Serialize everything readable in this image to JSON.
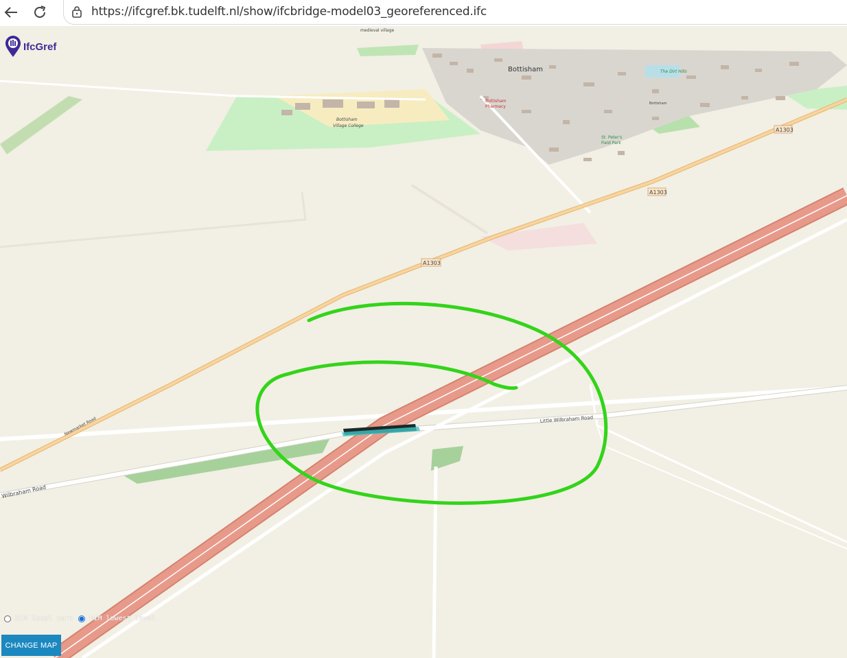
{
  "browser": {
    "url": "https://ifcgref.bk.tudelft.nl/show/ifcbridge-model03_georeferenced.ifc"
  },
  "app": {
    "logo_text": "IfcGref",
    "change_map_label": "CHANGE MAP",
    "radio_options": [
      {
        "label": "BIM local zero",
        "checked": false
      },
      {
        "label": "BIM lowest level",
        "checked": true
      }
    ]
  },
  "map_labels": {
    "medieval_village": "medieval village",
    "bottisham": "Bottisham",
    "the_dirt_hills": "The Dirt Hills",
    "village_college_1": "Bottisham",
    "village_college_2": "Village College",
    "pharmacy_1": "Bottisham",
    "pharmacy_2": "Pharmacy",
    "bottisham_small": "Bottisham",
    "field_park_1": "St. Peter's",
    "field_park_2": "Field Park",
    "a1303_1": "A1303",
    "a1303_2": "A1303",
    "a1303_3": "A1303",
    "newmarket_road": "Newmarket Road",
    "little_wilbraham_road": "Little Wilbraham Road",
    "wilbraham_road": "Wilbraham Road"
  },
  "colors": {
    "map_bg": "#f2efe4",
    "motorway": "#e89a8a",
    "a_road": "#f5c58a",
    "annotation": "#33d41a",
    "button": "#1b88c0"
  },
  "icons": [
    "back-arrow-icon",
    "reload-icon",
    "lock-icon",
    "ifcgref-pin-icon"
  ]
}
